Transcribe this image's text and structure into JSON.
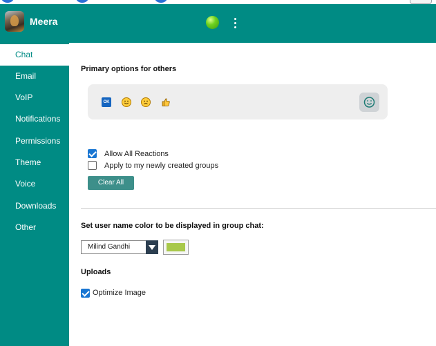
{
  "header": {
    "user_name": "Meera"
  },
  "sidebar": {
    "items": [
      {
        "label": "Chat",
        "active": true
      },
      {
        "label": "Email"
      },
      {
        "label": "VoIP"
      },
      {
        "label": "Notifications"
      },
      {
        "label": "Permissions"
      },
      {
        "label": "Theme"
      },
      {
        "label": "Voice"
      },
      {
        "label": "Downloads"
      },
      {
        "label": "Other"
      }
    ]
  },
  "reactions": {
    "title": "Primary options for others",
    "emojis": [
      "ok-button-icon",
      "smiling-face-icon",
      "sad-face-icon",
      "thumbs-up-icon"
    ],
    "ok_label": "OK",
    "picker_icon": "smiley-icon",
    "allow_all": {
      "label": "Allow All Reactions",
      "checked": true
    },
    "apply_new_groups": {
      "label": "Apply to my newly created groups",
      "checked": false
    },
    "clear_all_label": "Clear All"
  },
  "username_color": {
    "title": "Set user name color to be displayed in group chat:",
    "selected_user": "Milind Gandhi",
    "color": "#a8c84a"
  },
  "uploads": {
    "title": "Uploads",
    "optimize_image": {
      "label": "Optimize Image",
      "checked": true
    }
  },
  "colors": {
    "brand": "#008b84",
    "accent_button": "#3d8f8a",
    "checkbox": "#1976d2"
  }
}
